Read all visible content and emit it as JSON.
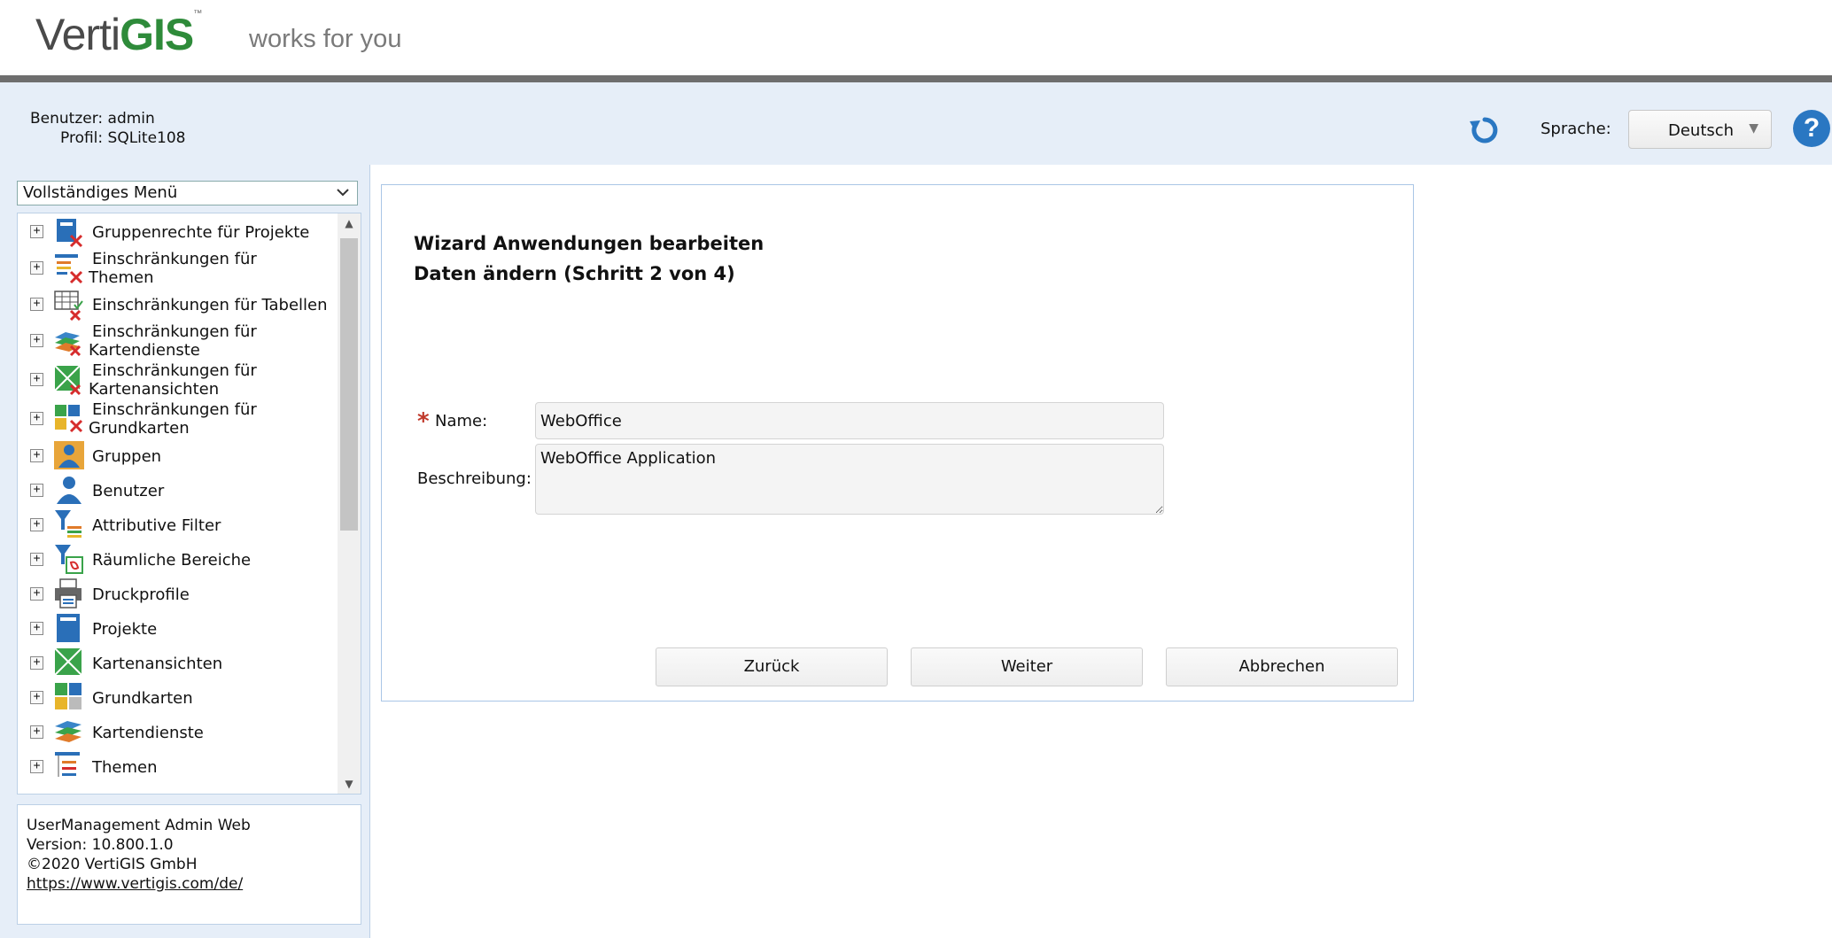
{
  "header": {
    "logo_verti": "Verti",
    "logo_gis": "GIS",
    "logo_tm": "™",
    "tagline": "works for you"
  },
  "user": {
    "user_line": "Benutzer: admin",
    "profile_line": "Profil: SQLite108"
  },
  "toolbar": {
    "refresh_icon": "refresh-icon",
    "language_label": "Sprache:",
    "language_value": "Deutsch",
    "help_label": "?"
  },
  "sidebar": {
    "menu_select": "Vollständiges Menü",
    "items": [
      {
        "line1": "Gruppenrechte für Projekte",
        "line2": "",
        "icon": "group-rights-projects-icon"
      },
      {
        "line1": "Einschränkungen für",
        "line2": "Themen",
        "icon": "restrictions-themes-icon"
      },
      {
        "line1": "Einschränkungen für Tabellen",
        "line2": "",
        "icon": "restrictions-tables-icon"
      },
      {
        "line1": "Einschränkungen für",
        "line2": "Kartendienste",
        "icon": "restrictions-mapservices-icon"
      },
      {
        "line1": "Einschränkungen für",
        "line2": "Kartenansichten",
        "icon": "restrictions-mapviews-icon"
      },
      {
        "line1": "Einschränkungen für",
        "line2": "Grundkarten",
        "icon": "restrictions-basemaps-icon"
      },
      {
        "line1": "Gruppen",
        "line2": "",
        "icon": "groups-icon"
      },
      {
        "line1": "Benutzer",
        "line2": "",
        "icon": "user-icon"
      },
      {
        "line1": "Attributive Filter",
        "line2": "",
        "icon": "attribute-filter-icon"
      },
      {
        "line1": "Räumliche Bereiche",
        "line2": "",
        "icon": "spatial-area-icon"
      },
      {
        "line1": "Druckprofile",
        "line2": "",
        "icon": "printer-icon"
      },
      {
        "line1": "Projekte",
        "line2": "",
        "icon": "projects-icon"
      },
      {
        "line1": "Kartenansichten",
        "line2": "",
        "icon": "mapviews-icon"
      },
      {
        "line1": "Grundkarten",
        "line2": "",
        "icon": "basemaps-icon"
      },
      {
        "line1": "Kartendienste",
        "line2": "",
        "icon": "mapservices-icon"
      },
      {
        "line1": "Themen",
        "line2": "",
        "icon": "themes-icon"
      }
    ],
    "info": {
      "app": "UserManagement Admin Web",
      "version": "Version: 10.800.1.0",
      "copyright": "©2020 VertiGIS GmbH",
      "link": "https://www.vertigis.com/de/"
    }
  },
  "wizard": {
    "title": "Wizard Anwendungen bearbeiten",
    "step": "Daten ändern (Schritt 2 von 4)",
    "required_mark": "*",
    "name_label": "Name:",
    "name_value": "WebOffice",
    "desc_label": "Beschreibung:",
    "desc_value": "WebOffice Application",
    "back_label": "Zurück",
    "next_label": "Weiter",
    "cancel_label": "Abbrechen"
  },
  "colors": {
    "accent_blue": "#2a77c2",
    "brand_green": "#2e8b3a",
    "required_red": "#c0392b",
    "background_light": "#e6eef8"
  }
}
